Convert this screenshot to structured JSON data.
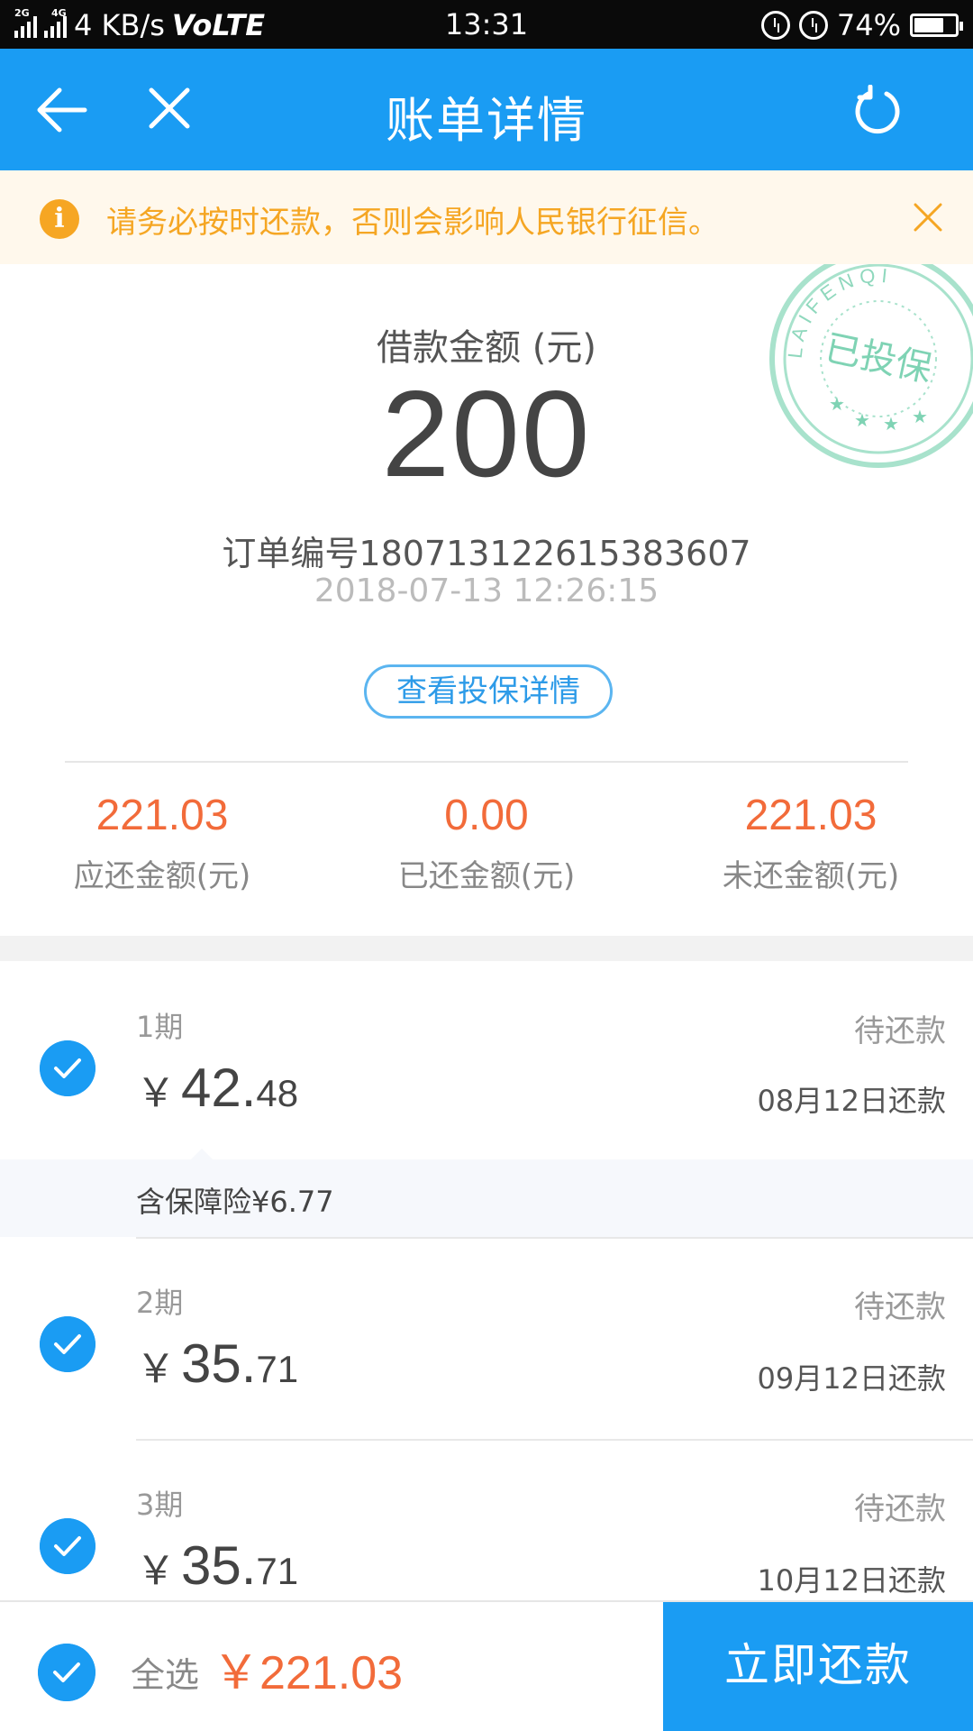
{
  "status_bar": {
    "net_tag_1": "2G",
    "net_tag_2": "4G",
    "speed": "4 KB/s",
    "volte": "VoLTE",
    "time": "13:31",
    "battery": "74%",
    "battery_level": 0.74
  },
  "nav": {
    "title": "账单详情",
    "back_icon": "arrow-left-icon",
    "close_icon": "close-icon",
    "refresh_icon": "refresh-icon"
  },
  "notice": {
    "icon": "info-icon",
    "icon_glyph": "i",
    "text": "请务必按时还款，否则会影响人民银行征信。"
  },
  "stamp": {
    "arc_text": "LAIFENQI",
    "center_text": "已投保"
  },
  "summary": {
    "loan_label": "借款金额 (元)",
    "loan_amount": "200",
    "order_no": "订单编号180713122615383607",
    "order_time": "2018-07-13 12:26:15",
    "insurance_button": "查看投保详情",
    "stats": [
      {
        "value": "221.03",
        "label": "应还金额(元)"
      },
      {
        "value": "0.00",
        "label": "已还金额(元)"
      },
      {
        "value": "221.03",
        "label": "未还金额(元)"
      }
    ]
  },
  "installments": [
    {
      "period": "1期",
      "currency": "￥",
      "amount_int": "42.",
      "amount_dec": "48",
      "status": "待还款",
      "due": "08月12日还款",
      "checked": true
    },
    {
      "period": "2期",
      "currency": "￥",
      "amount_int": "35.",
      "amount_dec": "71",
      "status": "待还款",
      "due": "09月12日还款",
      "checked": true
    },
    {
      "period": "3期",
      "currency": "￥",
      "amount_int": "35.",
      "amount_dec": "71",
      "status": "待还款",
      "due": "10月12日还款",
      "checked": true
    }
  ],
  "insurance_note": "含保障险¥6.77",
  "bottom": {
    "select_all": "全选",
    "total": "￥221.03",
    "pay_button": "立即还款"
  },
  "colors": {
    "primary": "#1a9cf3",
    "accent": "#f26b3a",
    "notice_bg": "#fff8ec",
    "notice_text": "#f5a623",
    "stamp": "#7fd3b4"
  }
}
